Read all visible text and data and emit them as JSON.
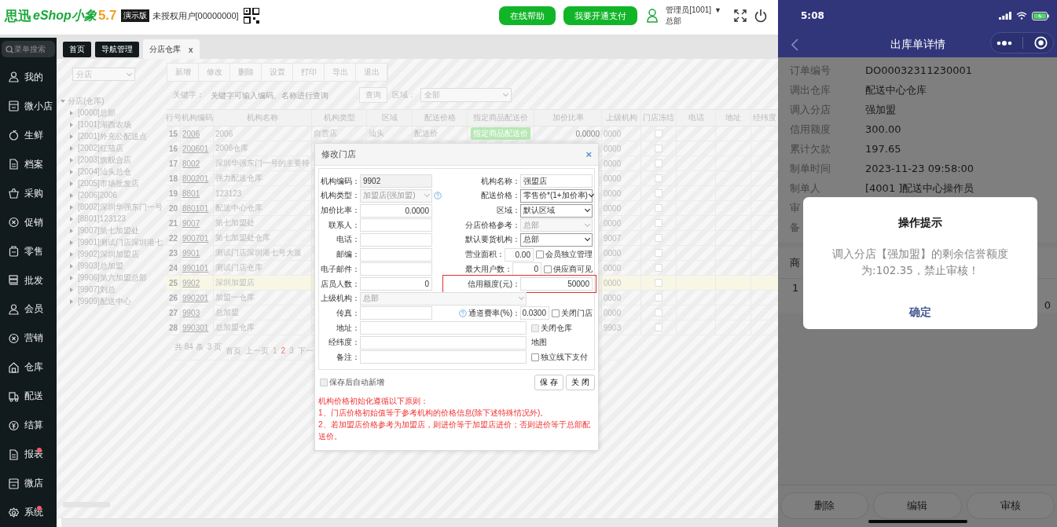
{
  "header": {
    "brand": "思迅",
    "product": "eShop小象",
    "version": "5.7",
    "edition": "演示版",
    "license": "未授权用户[00000000]",
    "buttons": [
      "在线帮助",
      "我要开通支付"
    ],
    "user": {
      "name": "管理员[1001]",
      "caret": "▼",
      "org": "总部"
    }
  },
  "sidebar": {
    "search": {
      "placeholder": "菜单搜索"
    },
    "items": [
      {
        "label": "我的",
        "dot": false
      },
      {
        "label": "微小店",
        "dot": false
      },
      {
        "label": "生鲜",
        "dot": false
      },
      {
        "label": "档案",
        "dot": false
      },
      {
        "label": "采购",
        "dot": false
      },
      {
        "label": "促销",
        "dot": false
      },
      {
        "label": "零售",
        "dot": false
      },
      {
        "label": "批发",
        "dot": false
      },
      {
        "label": "会员",
        "dot": false
      },
      {
        "label": "营销",
        "dot": false
      },
      {
        "label": "仓库",
        "dot": false
      },
      {
        "label": "配送",
        "dot": false
      },
      {
        "label": "结算",
        "dot": false
      },
      {
        "label": "报表",
        "dot": true
      },
      {
        "label": "微店",
        "dot": false
      },
      {
        "label": "系统",
        "dot": true
      }
    ]
  },
  "tabs": [
    {
      "label": "首页",
      "selected": false
    },
    {
      "label": "导航管理",
      "selected": false
    },
    {
      "label": "分店仓库",
      "selected": true,
      "close": "x"
    }
  ],
  "branch_select": {
    "value": "分店"
  },
  "toolbar": [
    "新增",
    "修改",
    "删除",
    "设置",
    "打印",
    "导出",
    "退出"
  ],
  "filter": {
    "keyword_label": "关键字：",
    "placeholder": "关键字可输入编码、名称进行查询",
    "query_button": "查询",
    "area_label": "区域：",
    "area_value": "全部"
  },
  "tree": {
    "label": "分店(仓库)",
    "expanded": true,
    "children": [
      {
        "label": "[0000]总部"
      },
      {
        "label": "[1001]湖西农场"
      },
      {
        "label": "[2001]外充公配送点"
      },
      {
        "label": "[2002]红茄店"
      },
      {
        "label": "[2003]旗舰合店"
      },
      {
        "label": "[2004]汕头总仓"
      },
      {
        "label": "[2005]市场批发店"
      },
      {
        "label": "[2006]2006"
      },
      {
        "label": "[8002]深圳华强东门一号"
      },
      {
        "label": "[8801]123123"
      },
      {
        "label": "[9007]第七加盟处"
      },
      {
        "label": "[9901]测试门店深圳港七"
      },
      {
        "label": "[9902]深圳加盟店"
      },
      {
        "label": "[9903]总加盟"
      },
      {
        "label": "[9906]第六加盟总部"
      },
      {
        "label": "[9907]刘总"
      },
      {
        "label": "[9909]配送中心"
      }
    ]
  },
  "table": {
    "columns": [
      "行号",
      "机构编码",
      "机构名称",
      "机构类型",
      "区域",
      "配送价格",
      "指定商品配送价",
      "加价比率",
      "上级机构",
      "门店冻结",
      "电话",
      "地址",
      "经纬度"
    ],
    "rows": [
      {
        "no": "15",
        "code": "2006",
        "name": "2006",
        "type": "自营店",
        "area": "汕头",
        "price": "配送价",
        "special": "指定商品配送价",
        "markup": "0.0000",
        "parent": "0000",
        "frozen": false,
        "selected": false
      },
      {
        "no": "16",
        "code": "200601",
        "name": "2006仓库",
        "parent": "0000",
        "frozen": false,
        "selected": false
      },
      {
        "no": "17",
        "code": "8002",
        "name": "深圳华强东门一号的主要特",
        "parent": "0000",
        "frozen": false,
        "selected": false
      },
      {
        "no": "18",
        "code": "800201",
        "name": "强力配送仓库",
        "parent": "0000",
        "frozen": false,
        "selected": false
      },
      {
        "no": "19",
        "code": "8801",
        "name": "123123",
        "parent": "0000",
        "frozen": false,
        "selected": false
      },
      {
        "no": "20",
        "code": "880101",
        "name": "配送中心仓库",
        "parent": "0000",
        "frozen": false,
        "selected": false
      },
      {
        "no": "21",
        "code": "9007",
        "name": "第七加盟处",
        "parent": "0000",
        "frozen": false,
        "selected": false
      },
      {
        "no": "22",
        "code": "900701",
        "name": "第七加盟处仓库",
        "parent": "9007",
        "frozen": false,
        "selected": false
      },
      {
        "no": "23",
        "code": "9901",
        "name": "测试门店深圳港七号大厦",
        "parent": "0000",
        "frozen": false,
        "selected": false
      },
      {
        "no": "24",
        "code": "990101",
        "name": "测试门店仓库",
        "parent": "0000",
        "frozen": false,
        "selected": false
      },
      {
        "no": "25",
        "code": "9902",
        "name": "深圳加盟店",
        "parent": "0000",
        "frozen": false,
        "selected": true
      },
      {
        "no": "26",
        "code": "990201",
        "name": "加盟一仓库",
        "parent": "0000",
        "frozen": false,
        "selected": false
      },
      {
        "no": "27",
        "code": "9903",
        "name": "总加盟",
        "parent": "0000",
        "frozen": false,
        "selected": false
      },
      {
        "no": "28",
        "code": "990301",
        "name": "总加盟仓库",
        "parent": "9903",
        "frozen": false,
        "selected": false
      }
    ],
    "pager": {
      "total": "共 84 条",
      "pages": "3 页",
      "first": "首页",
      "prev": "上一页",
      "numbers": [
        {
          "label": "1",
          "selected": false
        },
        {
          "label": "2",
          "selected": true
        },
        {
          "label": "3",
          "selected": false
        }
      ],
      "next": "下一"
    }
  },
  "dialog": {
    "title": "修改门店",
    "close": "×",
    "rows": [
      {
        "left": {
          "label": "机构编码：",
          "value": "9902",
          "kind": "readonly"
        },
        "right": {
          "label": "机构名称：",
          "value": "强盟店",
          "kind": "input"
        }
      },
      {
        "left": {
          "label": "机构类型：",
          "value": "加盟店(强加盟)",
          "kind": "locked",
          "help": true
        },
        "right": {
          "label": "配送价格：",
          "value": "零售价*(1+加价率)",
          "kind": "select"
        }
      },
      {
        "left": {
          "label": "加价比率：",
          "value": "0.0000",
          "kind": "number"
        },
        "right": {
          "label": "区域：",
          "value": "默认区域",
          "kind": "select"
        }
      },
      {
        "left": {
          "label": "联系人：",
          "kind": "input"
        },
        "right": {
          "label": "分店价格参考：",
          "value": "总部",
          "kind": "locked"
        }
      },
      {
        "left": {
          "label": "电话：",
          "kind": "input"
        },
        "right": {
          "label": "默认要货机构：",
          "value": "总部",
          "kind": "select"
        }
      },
      {
        "left": {
          "label": "邮编：",
          "kind": "input"
        },
        "right": {
          "label": "营业面积：",
          "value": "0.00",
          "kind": "small",
          "extra": {
            "kind": "checkbox",
            "label": "会员独立管理",
            "checked": false,
            "disabled": false
          }
        }
      },
      {
        "left": {
          "label": "电子邮件：",
          "kind": "input"
        },
        "right": {
          "label": "最大用户数：",
          "value": "0",
          "kind": "small",
          "extra": {
            "kind": "checkbox",
            "label": "供应商可见",
            "checked": false,
            "disabled": false
          }
        }
      },
      {
        "left": {
          "label": "店员人数：",
          "value": "0",
          "kind": "number"
        },
        "right": {
          "label": "信用额度(元)：",
          "value": "50000",
          "kind": "number",
          "highlighted": true
        }
      },
      {
        "wide": {
          "label": "上级机构：",
          "value": "总部",
          "kind": "locked"
        }
      },
      {
        "left": {
          "label": "传真：",
          "kind": "input"
        },
        "right": {
          "label": "通道费率(%)：",
          "value": "0.0300",
          "kind": "small",
          "help": true,
          "extra": {
            "kind": "checkbox",
            "label": "关闭门店",
            "checked": false,
            "disabled": false
          }
        }
      },
      {
        "wide": {
          "label": "地址：",
          "kind": "input",
          "extra": {
            "kind": "checkbox",
            "label": "关闭仓库",
            "checked": false,
            "disabled": true
          }
        }
      },
      {
        "wide": {
          "label": "经纬度：",
          "kind": "input",
          "extra": {
            "kind": "link",
            "label": "地图"
          }
        }
      },
      {
        "wide": {
          "label": "备注：",
          "kind": "input",
          "extra": {
            "kind": "checkbox",
            "label": "独立线下支付",
            "checked": false,
            "disabled": false
          }
        }
      }
    ],
    "auto_new": {
      "label": "保存后自动新增",
      "checked": false
    },
    "buttons": [
      "保 存",
      "关 闭"
    ],
    "notes": [
      "机构价格初始化遵循以下原则：",
      "1、门店价格初始值等于参考机构的价格信息(除下述特殊情况外)。",
      "2、若加盟店价格参考为加盟店，则进价等于加盟店进价；否则进价等于总部配送价。"
    ]
  },
  "phone": {
    "time": "5:08",
    "title": "出库单详情",
    "details": [
      {
        "label": "订单编号",
        "value": "DO00032311230001"
      },
      {
        "label": "调出仓库",
        "value": "配送中心仓库"
      },
      {
        "label": "调入分店",
        "value": "强加盟"
      },
      {
        "label": "信用额度",
        "value": "300.00"
      },
      {
        "label": "累计欠款",
        "value": "197.65"
      },
      {
        "label": "制单时间",
        "value": "2023-11-23 09:58:00"
      },
      {
        "label": "制单人",
        "value": "[4001 ]配送中心操作员"
      },
      {
        "label": "审"
      },
      {
        "label": "备"
      }
    ],
    "goods": {
      "heading": "商",
      "row_no": "1",
      "amount": "0"
    },
    "modal": {
      "title": "操作提示",
      "message": "调入分店【强加盟】的剩余信誉额度为:102.35，禁止审核！",
      "confirm": "确定"
    },
    "actions": [
      "删除",
      "编辑",
      "审核"
    ]
  }
}
